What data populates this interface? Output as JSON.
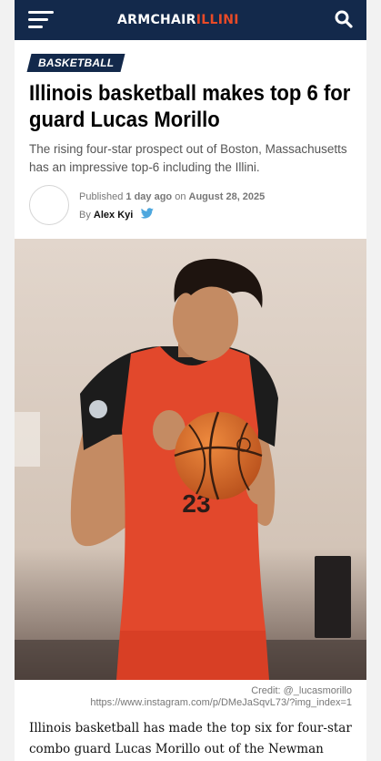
{
  "header": {
    "logo_primary": "ARMCHAIR",
    "logo_accent": "ILLINI",
    "brand_color": "#13294b",
    "accent_color": "#e84a27",
    "menu_icon": "hamburger-menu-icon",
    "search_icon": "search-icon"
  },
  "article": {
    "category": "BASKETBALL",
    "headline": "Illinois basketball makes top 6 for guard Lucas Morillo",
    "dek": "The rising four-star prospect out of Boston, Massachusetts has an impressive top-6 including the Illini.",
    "published_label": "Published",
    "published_ago": "1 day ago",
    "on_label": "on",
    "published_date": "August 28, 2025",
    "by_label": "By",
    "author": "Alex Kyi",
    "author_social_icon": "twitter-icon",
    "image_credit": "Credit: @_lucasmorillo",
    "image_source": "https://www.instagram.com/p/DMeJaSqvL73/?img_index=1",
    "body_first": "Illinois basketball has made the top six for four-star combo guard Lucas Morillo out of the Newman School",
    "jersey_number": "23"
  }
}
